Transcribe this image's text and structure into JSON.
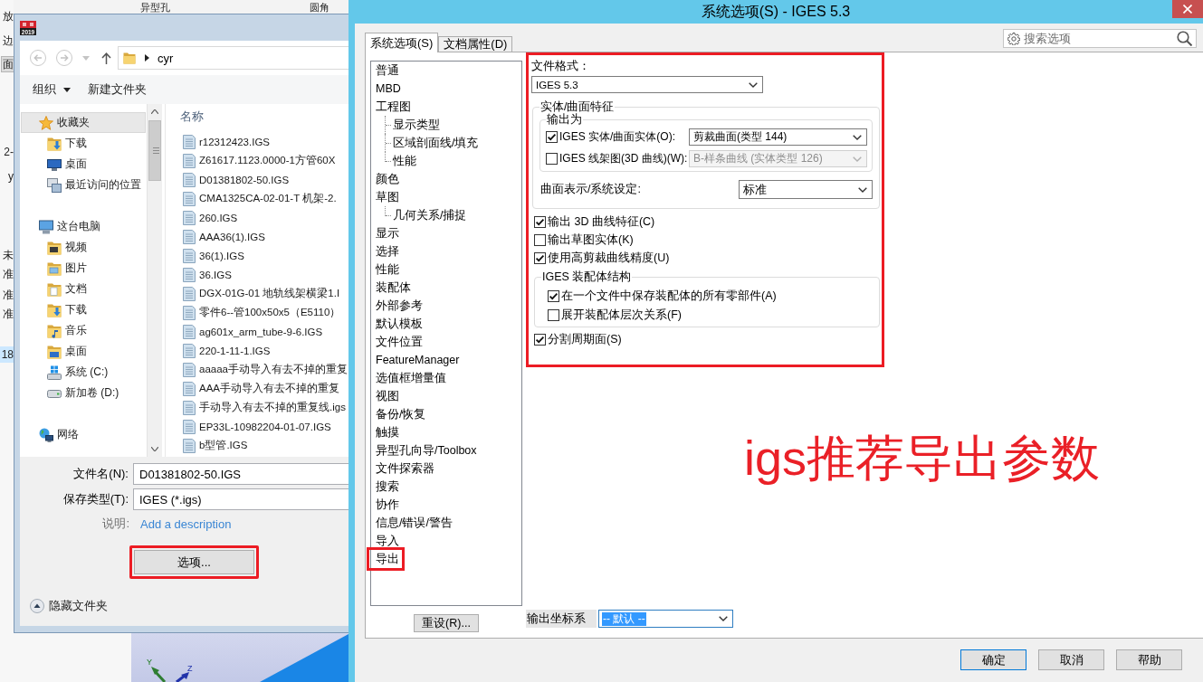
{
  "app_background": {
    "toolbar_labels": [
      "异型孔",
      "圆角"
    ],
    "side_items": [
      {
        "text": "放",
        "kind": "label",
        "selected": false
      },
      {
        "text": "边",
        "kind": "label",
        "selected": false
      },
      {
        "text": "面",
        "kind": "button",
        "selected": false
      },
      {
        "text": "2-",
        "kind": "label",
        "selected": false
      },
      {
        "text": "y",
        "kind": "label",
        "selected": false
      },
      {
        "text": "未",
        "kind": "label",
        "selected": false
      },
      {
        "text": "准",
        "kind": "label",
        "selected": false
      },
      {
        "text": "准",
        "kind": "label",
        "selected": false
      },
      {
        "text": "准",
        "kind": "label",
        "selected": false
      },
      {
        "text": "18",
        "kind": "label",
        "selected": true
      }
    ],
    "viewport": {
      "axis_labels": [
        "Y",
        "Z"
      ]
    }
  },
  "file_dialog": {
    "app_badge": "2019",
    "address": {
      "path": "cyr"
    },
    "toolbar": [
      {
        "label": "组织",
        "dropdown": true
      },
      {
        "label": "新建文件夹",
        "dropdown": false
      }
    ],
    "nav": [
      {
        "label": "收藏夹",
        "kind": "favorites",
        "selected": true,
        "children": [
          {
            "label": "下载",
            "kind": "downloads",
            "selected": false
          },
          {
            "label": "桌面",
            "kind": "desktop",
            "selected": false
          },
          {
            "label": "最近访问的位置",
            "kind": "recent",
            "selected": false
          }
        ]
      },
      {
        "label": "这台电脑",
        "kind": "computer",
        "selected": false,
        "children": [
          {
            "label": "视频",
            "kind": "videos",
            "selected": false
          },
          {
            "label": "图片",
            "kind": "pictures",
            "selected": false
          },
          {
            "label": "文档",
            "kind": "documents",
            "selected": false
          },
          {
            "label": "下载",
            "kind": "downloads",
            "selected": false
          },
          {
            "label": "音乐",
            "kind": "music",
            "selected": false
          },
          {
            "label": "桌面",
            "kind": "desktop_folder",
            "selected": false
          },
          {
            "label": "系统 (C:)",
            "kind": "system_drive",
            "selected": false
          },
          {
            "label": "新加卷 (D:)",
            "kind": "drive",
            "selected": false
          }
        ]
      },
      {
        "label": "网络",
        "kind": "network",
        "selected": false
      }
    ],
    "columns": [
      "名称"
    ],
    "files": [
      "r12312423.IGS",
      "Z61617.1123.0000-1方管60X",
      "D01381802-50.IGS",
      "CMA1325CA-02-01-T 机架-2.",
      "260.IGS",
      "AAA36(1).IGS",
      "36(1).IGS",
      "36.IGS",
      "DGX-01G-01 地轨线架横梁1.I",
      "零件6--管100x50x5（E5110）",
      "ag601x_arm_tube-9-6.IGS",
      "220-1-11-1.IGS",
      "aaaaa手动导入有去不掉的重复",
      "AAA手动导入有去不掉的重复",
      "手动导入有去不掉的重复线.igs",
      "EP33L-10982204-01-07.IGS",
      "b型管.IGS"
    ],
    "fields": [
      {
        "label": "文件名(N):",
        "value": "D01381802-50.IGS"
      },
      {
        "label": "保存类型(T):",
        "value": "IGES (*.igs)"
      }
    ],
    "description": {
      "label": "说明:",
      "link": "Add a description"
    },
    "options_button": {
      "label": "选项...",
      "highlighted": true
    },
    "hide_folders": "隐藏文件夹"
  },
  "system_dialog": {
    "title": "系统选项(S) - IGES 5.3",
    "tabs": [
      {
        "label": "系统选项(S)",
        "selected": true
      },
      {
        "label": "文档属性(D)",
        "selected": false
      }
    ],
    "search": {
      "placeholder": "搜索选项"
    },
    "tree": [
      {
        "label": "普通",
        "highlighted": false
      },
      {
        "label": "MBD",
        "highlighted": false
      },
      {
        "label": "工程图",
        "highlighted": false,
        "children": [
          {
            "label": "显示类型",
            "highlighted": false
          },
          {
            "label": "区域剖面线/填充",
            "highlighted": false
          },
          {
            "label": "性能",
            "highlighted": false
          }
        ]
      },
      {
        "label": "颜色",
        "highlighted": false
      },
      {
        "label": "草图",
        "highlighted": false,
        "children": [
          {
            "label": "几何关系/捕捉",
            "highlighted": false
          }
        ]
      },
      {
        "label": "显示",
        "highlighted": false
      },
      {
        "label": "选择",
        "highlighted": false
      },
      {
        "label": "性能",
        "highlighted": false
      },
      {
        "label": "装配体",
        "highlighted": false
      },
      {
        "label": "外部参考",
        "highlighted": false
      },
      {
        "label": "默认模板",
        "highlighted": false
      },
      {
        "label": "文件位置",
        "highlighted": false
      },
      {
        "label": "FeatureManager",
        "highlighted": false
      },
      {
        "label": "选值框增量值",
        "highlighted": false
      },
      {
        "label": "视图",
        "highlighted": false
      },
      {
        "label": "备份/恢复",
        "highlighted": false
      },
      {
        "label": "触摸",
        "highlighted": false
      },
      {
        "label": "异型孔向导/Toolbox",
        "highlighted": false
      },
      {
        "label": "文件探索器",
        "highlighted": false
      },
      {
        "label": "搜索",
        "highlighted": false
      },
      {
        "label": "协作",
        "highlighted": false
      },
      {
        "label": "信息/错误/警告",
        "highlighted": false
      },
      {
        "label": "导入",
        "highlighted": false
      },
      {
        "label": "导出",
        "highlighted": true
      }
    ],
    "reset_button": "重设(R)...",
    "options": {
      "highlighted": true,
      "format_label": "文件格式：",
      "format": "IGES 5.3",
      "solid_group": {
        "title": "实体/曲面特征",
        "output_group": {
          "title": "输出为",
          "rows": [
            {
              "label": "IGES 实体/曲面实体(O):",
              "checked": true,
              "value": "剪裁曲面(类型 144)",
              "disabled": false
            },
            {
              "label": "IGES 线架图(3D 曲线)(W):",
              "checked": false,
              "value": "B-样条曲线 (实体类型 126)",
              "disabled": true
            }
          ]
        },
        "surface": {
          "label": "曲面表示/系统设定:",
          "value": "标准"
        }
      },
      "checks": [
        {
          "label": "输出 3D 曲线特征(C)",
          "checked": true
        },
        {
          "label": "输出草图实体(K)",
          "checked": false
        },
        {
          "label": "使用高剪裁曲线精度(U)",
          "checked": true
        }
      ],
      "assembly_group": {
        "title": "IGES 装配体结构",
        "checks": [
          {
            "label": "在一个文件中保存装配体的所有零部件(A)",
            "checked": true
          },
          {
            "label": "展开装配体层次关系(F)",
            "checked": false
          }
        ]
      },
      "split": {
        "label": "分割周期面(S)",
        "checked": true
      }
    },
    "annotation": "igs推荐导出参数",
    "coordinate_system": {
      "label": "输出坐标系",
      "value": "-- 默认 --"
    },
    "buttons": [
      {
        "label": "确定",
        "default": true
      },
      {
        "label": "取消",
        "default": false
      },
      {
        "label": "帮助",
        "default": false
      }
    ]
  }
}
